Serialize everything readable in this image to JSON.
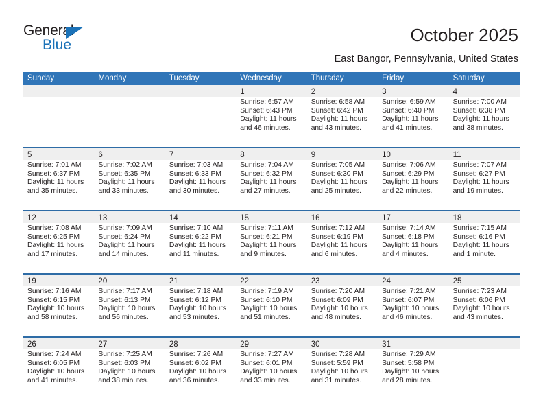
{
  "brand": {
    "name_top": "General",
    "name_bottom": "Blue",
    "triangle_color": "#1b72b8"
  },
  "header": {
    "title": "October 2025",
    "subtitle": "East Bangor, Pennsylvania, United States",
    "accent_color": "#3075b8",
    "row_divider_color": "#2e6ca6",
    "daynum_band_color": "#efefef"
  },
  "weekdays": [
    "Sunday",
    "Monday",
    "Tuesday",
    "Wednesday",
    "Thursday",
    "Friday",
    "Saturday"
  ],
  "weeks": [
    [
      {
        "day": "",
        "empty": true
      },
      {
        "day": "",
        "empty": true
      },
      {
        "day": "",
        "empty": true
      },
      {
        "day": "1",
        "sunrise": "Sunrise: 6:57 AM",
        "sunset": "Sunset: 6:43 PM",
        "daylight": "Daylight: 11 hours and 46 minutes."
      },
      {
        "day": "2",
        "sunrise": "Sunrise: 6:58 AM",
        "sunset": "Sunset: 6:42 PM",
        "daylight": "Daylight: 11 hours and 43 minutes."
      },
      {
        "day": "3",
        "sunrise": "Sunrise: 6:59 AM",
        "sunset": "Sunset: 6:40 PM",
        "daylight": "Daylight: 11 hours and 41 minutes."
      },
      {
        "day": "4",
        "sunrise": "Sunrise: 7:00 AM",
        "sunset": "Sunset: 6:38 PM",
        "daylight": "Daylight: 11 hours and 38 minutes."
      }
    ],
    [
      {
        "day": "5",
        "sunrise": "Sunrise: 7:01 AM",
        "sunset": "Sunset: 6:37 PM",
        "daylight": "Daylight: 11 hours and 35 minutes."
      },
      {
        "day": "6",
        "sunrise": "Sunrise: 7:02 AM",
        "sunset": "Sunset: 6:35 PM",
        "daylight": "Daylight: 11 hours and 33 minutes."
      },
      {
        "day": "7",
        "sunrise": "Sunrise: 7:03 AM",
        "sunset": "Sunset: 6:33 PM",
        "daylight": "Daylight: 11 hours and 30 minutes."
      },
      {
        "day": "8",
        "sunrise": "Sunrise: 7:04 AM",
        "sunset": "Sunset: 6:32 PM",
        "daylight": "Daylight: 11 hours and 27 minutes."
      },
      {
        "day": "9",
        "sunrise": "Sunrise: 7:05 AM",
        "sunset": "Sunset: 6:30 PM",
        "daylight": "Daylight: 11 hours and 25 minutes."
      },
      {
        "day": "10",
        "sunrise": "Sunrise: 7:06 AM",
        "sunset": "Sunset: 6:29 PM",
        "daylight": "Daylight: 11 hours and 22 minutes."
      },
      {
        "day": "11",
        "sunrise": "Sunrise: 7:07 AM",
        "sunset": "Sunset: 6:27 PM",
        "daylight": "Daylight: 11 hours and 19 minutes."
      }
    ],
    [
      {
        "day": "12",
        "sunrise": "Sunrise: 7:08 AM",
        "sunset": "Sunset: 6:25 PM",
        "daylight": "Daylight: 11 hours and 17 minutes."
      },
      {
        "day": "13",
        "sunrise": "Sunrise: 7:09 AM",
        "sunset": "Sunset: 6:24 PM",
        "daylight": "Daylight: 11 hours and 14 minutes."
      },
      {
        "day": "14",
        "sunrise": "Sunrise: 7:10 AM",
        "sunset": "Sunset: 6:22 PM",
        "daylight": "Daylight: 11 hours and 11 minutes."
      },
      {
        "day": "15",
        "sunrise": "Sunrise: 7:11 AM",
        "sunset": "Sunset: 6:21 PM",
        "daylight": "Daylight: 11 hours and 9 minutes."
      },
      {
        "day": "16",
        "sunrise": "Sunrise: 7:12 AM",
        "sunset": "Sunset: 6:19 PM",
        "daylight": "Daylight: 11 hours and 6 minutes."
      },
      {
        "day": "17",
        "sunrise": "Sunrise: 7:14 AM",
        "sunset": "Sunset: 6:18 PM",
        "daylight": "Daylight: 11 hours and 4 minutes."
      },
      {
        "day": "18",
        "sunrise": "Sunrise: 7:15 AM",
        "sunset": "Sunset: 6:16 PM",
        "daylight": "Daylight: 11 hours and 1 minute."
      }
    ],
    [
      {
        "day": "19",
        "sunrise": "Sunrise: 7:16 AM",
        "sunset": "Sunset: 6:15 PM",
        "daylight": "Daylight: 10 hours and 58 minutes."
      },
      {
        "day": "20",
        "sunrise": "Sunrise: 7:17 AM",
        "sunset": "Sunset: 6:13 PM",
        "daylight": "Daylight: 10 hours and 56 minutes."
      },
      {
        "day": "21",
        "sunrise": "Sunrise: 7:18 AM",
        "sunset": "Sunset: 6:12 PM",
        "daylight": "Daylight: 10 hours and 53 minutes."
      },
      {
        "day": "22",
        "sunrise": "Sunrise: 7:19 AM",
        "sunset": "Sunset: 6:10 PM",
        "daylight": "Daylight: 10 hours and 51 minutes."
      },
      {
        "day": "23",
        "sunrise": "Sunrise: 7:20 AM",
        "sunset": "Sunset: 6:09 PM",
        "daylight": "Daylight: 10 hours and 48 minutes."
      },
      {
        "day": "24",
        "sunrise": "Sunrise: 7:21 AM",
        "sunset": "Sunset: 6:07 PM",
        "daylight": "Daylight: 10 hours and 46 minutes."
      },
      {
        "day": "25",
        "sunrise": "Sunrise: 7:23 AM",
        "sunset": "Sunset: 6:06 PM",
        "daylight": "Daylight: 10 hours and 43 minutes."
      }
    ],
    [
      {
        "day": "26",
        "sunrise": "Sunrise: 7:24 AM",
        "sunset": "Sunset: 6:05 PM",
        "daylight": "Daylight: 10 hours and 41 minutes."
      },
      {
        "day": "27",
        "sunrise": "Sunrise: 7:25 AM",
        "sunset": "Sunset: 6:03 PM",
        "daylight": "Daylight: 10 hours and 38 minutes."
      },
      {
        "day": "28",
        "sunrise": "Sunrise: 7:26 AM",
        "sunset": "Sunset: 6:02 PM",
        "daylight": "Daylight: 10 hours and 36 minutes."
      },
      {
        "day": "29",
        "sunrise": "Sunrise: 7:27 AM",
        "sunset": "Sunset: 6:01 PM",
        "daylight": "Daylight: 10 hours and 33 minutes."
      },
      {
        "day": "30",
        "sunrise": "Sunrise: 7:28 AM",
        "sunset": "Sunset: 5:59 PM",
        "daylight": "Daylight: 10 hours and 31 minutes."
      },
      {
        "day": "31",
        "sunrise": "Sunrise: 7:29 AM",
        "sunset": "Sunset: 5:58 PM",
        "daylight": "Daylight: 10 hours and 28 minutes."
      },
      {
        "day": "",
        "empty": true
      }
    ]
  ]
}
